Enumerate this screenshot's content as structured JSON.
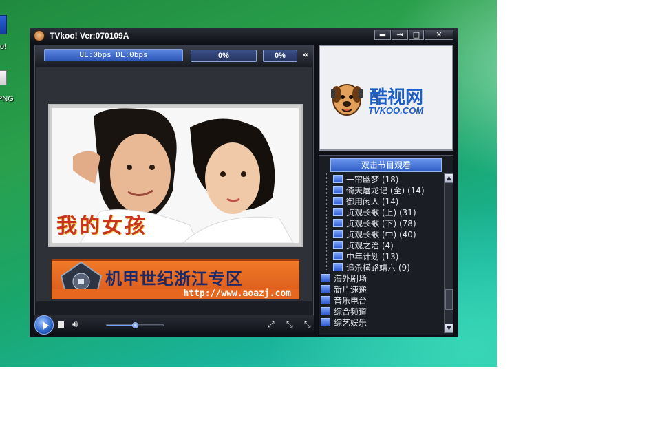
{
  "desktop": {
    "icons": [
      {
        "label": "o!"
      },
      {
        "label": "PNG"
      }
    ]
  },
  "window": {
    "title": "TVkoo! Ver:070109A",
    "buttons": {
      "minimize": "▬",
      "pin": "⇥",
      "maximize": "□",
      "close": "✕"
    }
  },
  "status": {
    "speed": "UL:0bps  DL:0bps",
    "buffer_percent": "0%",
    "progress_percent": "0%"
  },
  "player": {
    "photo_caption": "我的女孩",
    "banner_text": "机甲世纪浙江专区",
    "banner_url": "http://www.aoazj.com",
    "seek_position": 0.5
  },
  "logo": {
    "cn": "酷视网",
    "en": "TVKOO.COM"
  },
  "channels": {
    "header": "双击节目观看",
    "items": [
      {
        "label": "一帘幽梦 (18)",
        "level": 2
      },
      {
        "label": "倚天屠龙记 (全) (14)",
        "level": 2
      },
      {
        "label": "御用闲人 (14)",
        "level": 2
      },
      {
        "label": "贞观长歌 (上) (31)",
        "level": 2
      },
      {
        "label": "贞观长歌 (下) (78)",
        "level": 2
      },
      {
        "label": "贞观长歌 (中) (40)",
        "level": 2
      },
      {
        "label": "贞观之治 (4)",
        "level": 2
      },
      {
        "label": "中年计划 (13)",
        "level": 2
      },
      {
        "label": "追杀横路靖六 (9)",
        "level": 2
      },
      {
        "label": "海外剧场",
        "level": 1
      },
      {
        "label": "新片速递",
        "level": 1
      },
      {
        "label": "音乐电台",
        "level": 1
      },
      {
        "label": "综合频道",
        "level": 1
      },
      {
        "label": "综艺娱乐",
        "level": 1
      }
    ]
  },
  "colors": {
    "accent_blue": "#2f58b8",
    "window_bg": "#0e1016",
    "banner_orange": "#e8671e"
  }
}
